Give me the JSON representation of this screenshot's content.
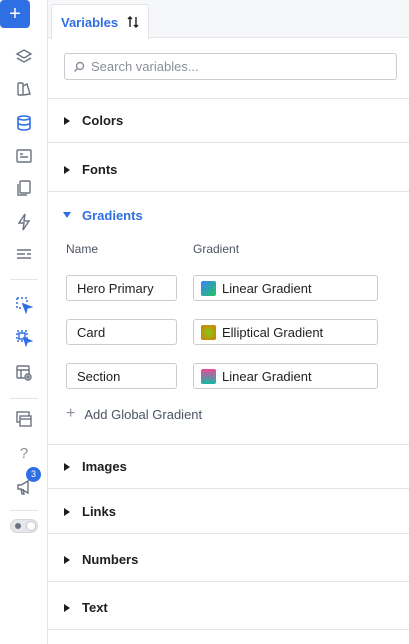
{
  "tab": {
    "label": "Variables"
  },
  "search": {
    "placeholder": "Search variables..."
  },
  "sections": {
    "colors": "Colors",
    "fonts": "Fonts",
    "gradients": "Gradients",
    "images": "Images",
    "links": "Links",
    "numbers": "Numbers",
    "text": "Text"
  },
  "gradients": {
    "name_header": "Name",
    "gradient_header": "Gradient",
    "rows": [
      {
        "name": "Hero Primary",
        "type": "Linear Gradient",
        "swatch": [
          "#3b82f6",
          "#22c55e"
        ]
      },
      {
        "name": "Card",
        "type": "Elliptical Gradient",
        "swatch": [
          "#84cc16",
          "#d97706"
        ]
      },
      {
        "name": "Section",
        "type": "Linear Gradient",
        "swatch": [
          "#ec4899",
          "#14b8a6"
        ]
      }
    ],
    "add_label": "Add Global Gradient"
  },
  "rail": {
    "help_label": "?",
    "notifications_count": "3"
  },
  "colors": {
    "accent": "#2f6fe4",
    "border": "#e2e4e7"
  }
}
